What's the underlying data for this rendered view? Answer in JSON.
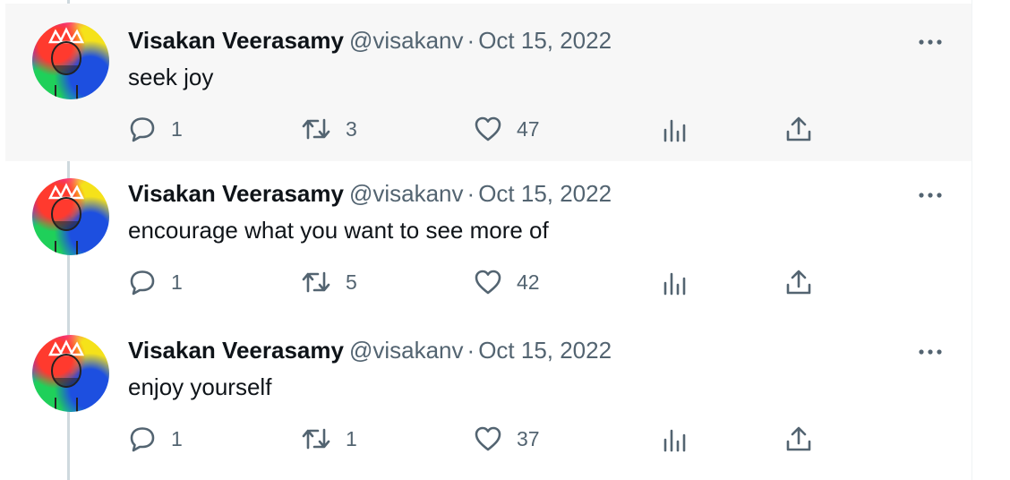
{
  "tweets": [
    {
      "name": "Visakan Veerasamy",
      "handle": "@visakanv",
      "dot": "·",
      "date": "Oct 15, 2022",
      "text": "seek joy",
      "replies": "1",
      "retweets": "3",
      "likes": "47",
      "highlighted": true
    },
    {
      "name": "Visakan Veerasamy",
      "handle": "@visakanv",
      "dot": "·",
      "date": "Oct 15, 2022",
      "text": "encourage what you want to see more of",
      "replies": "1",
      "retweets": "5",
      "likes": "42",
      "highlighted": false
    },
    {
      "name": "Visakan Veerasamy",
      "handle": "@visakanv",
      "dot": "·",
      "date": "Oct 15, 2022",
      "text": "enjoy yourself",
      "replies": "1",
      "retweets": "1",
      "likes": "37",
      "highlighted": false
    }
  ],
  "icons": {
    "reply": "reply-icon",
    "retweet": "retweet-icon",
    "like": "heart-icon",
    "views": "views-icon",
    "share": "share-icon",
    "more": "more-icon"
  },
  "colors": {
    "text_primary": "#0f1419",
    "text_secondary": "#536471",
    "hover_background": "#f7f7f7",
    "thread_line": "#cfd9de"
  }
}
